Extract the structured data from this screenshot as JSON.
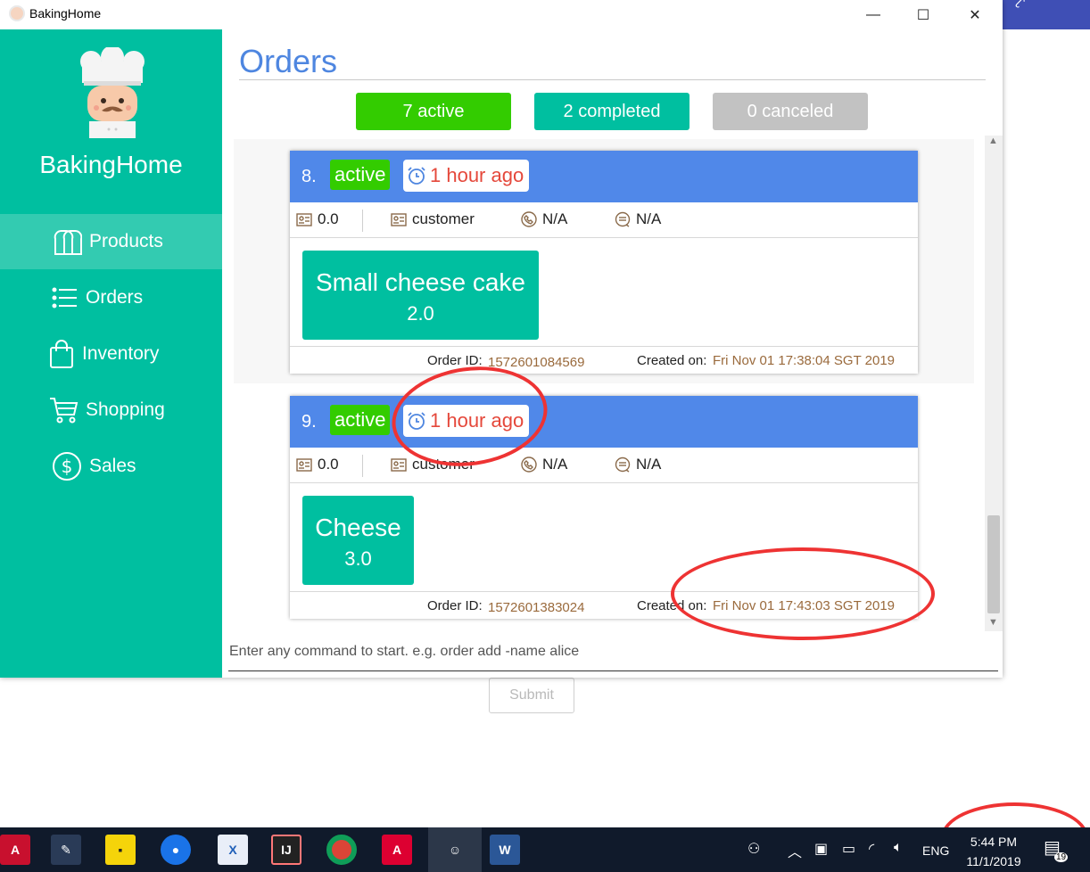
{
  "window": {
    "title": "BakingHome",
    "minimize": "—",
    "maximize": "☐",
    "close": "✕"
  },
  "sidebar": {
    "brand": "BakingHome",
    "items": [
      {
        "label": "Products",
        "icon": "bread-icon",
        "active": true
      },
      {
        "label": "Orders",
        "icon": "list-icon",
        "active": false
      },
      {
        "label": "Inventory",
        "icon": "bag-icon",
        "active": false
      },
      {
        "label": "Shopping",
        "icon": "cart-icon",
        "active": false
      },
      {
        "label": "Sales",
        "icon": "dollar-icon",
        "active": false
      }
    ]
  },
  "main": {
    "title": "Orders",
    "tabs": [
      {
        "label": "7 active",
        "color": "#33cc00"
      },
      {
        "label": "2 completed",
        "color": "#00bfa0"
      },
      {
        "label": "0 canceled",
        "color": "#c2c2c2"
      }
    ],
    "orders": [
      {
        "number": "8.",
        "status": "active",
        "time": "1 hour ago",
        "total": "0.0",
        "customer": "customer",
        "phone": "N/A",
        "remark": "N/A",
        "items": [
          {
            "name": "Small cheese cake",
            "qty": "2.0"
          }
        ],
        "order_id_label": "Order ID:",
        "order_id": "1572601084569",
        "created_label": "Created on:",
        "created_on": "Fri Nov 01 17:38:04 SGT 2019"
      },
      {
        "number": "9.",
        "status": "active",
        "time": "1 hour ago",
        "total": "0.0",
        "customer": "customer",
        "phone": "N/A",
        "remark": "N/A",
        "items": [
          {
            "name": "Cheese",
            "qty": "3.0"
          }
        ],
        "order_id_label": "Order ID:",
        "order_id": "1572601383024",
        "created_label": "Created on:",
        "created_on": "Fri Nov 01 17:43:03 SGT 2019"
      }
    ],
    "command_placeholder": "Enter any command to start. e.g. order add -name alice"
  },
  "behind": {
    "submit_label": "Submit"
  },
  "taskbar": {
    "apps": [
      "acrobat",
      "eclipse",
      "sticky-notes",
      "maps",
      "xmind",
      "intellij",
      "chrome",
      "angular",
      "bakinghome",
      "word"
    ],
    "language": "ENG",
    "time": "5:44 PM",
    "date": "11/1/2019",
    "notifications": "19"
  }
}
